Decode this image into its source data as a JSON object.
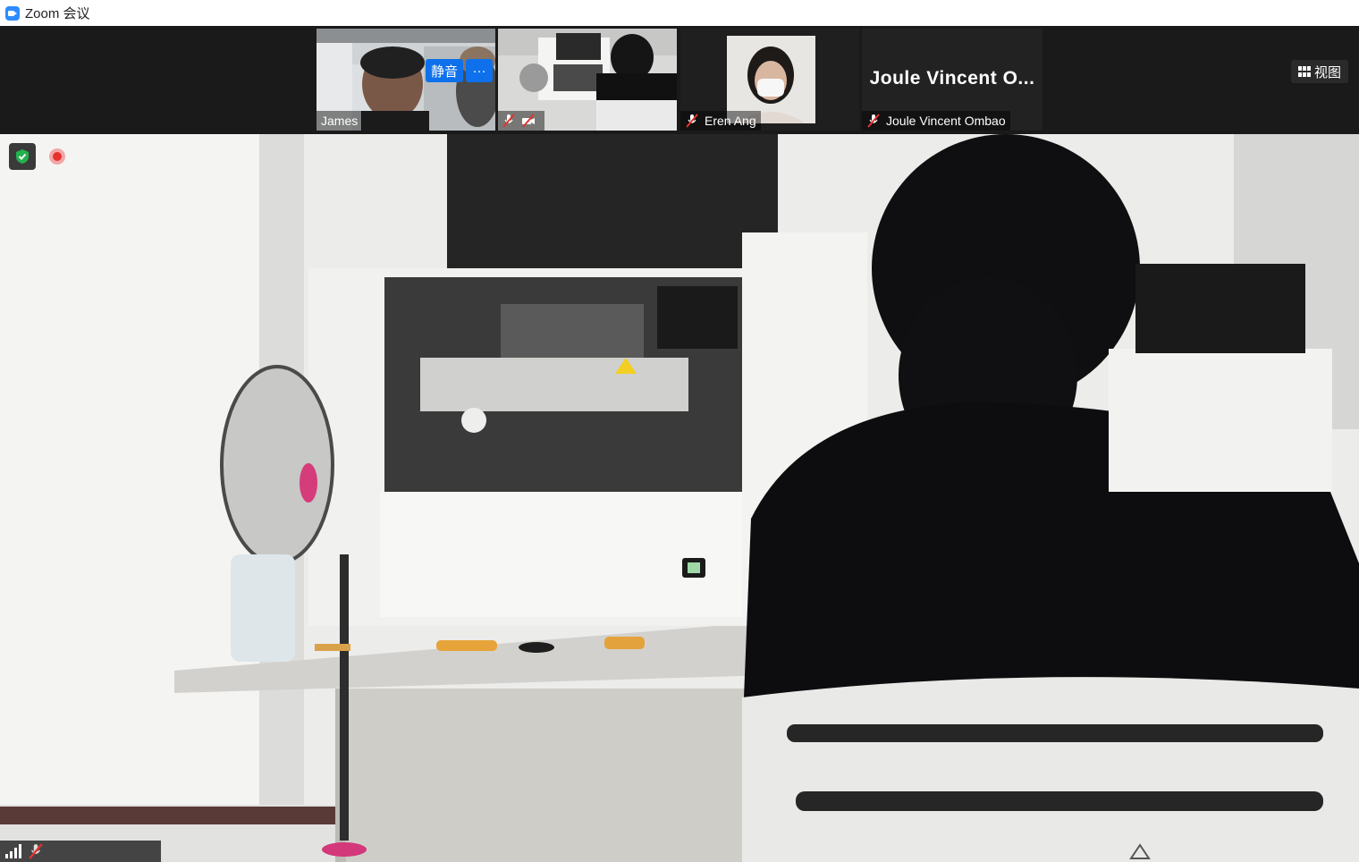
{
  "window": {
    "title": "Zoom 会议"
  },
  "toolbar": {
    "view_label": "视图"
  },
  "thumbnails": {
    "tile1": {
      "name": "James",
      "mute_button": "静音",
      "more_button": "···"
    },
    "tile2": {
      "name": ""
    },
    "tile3": {
      "name": "Eren Ang"
    },
    "tile4": {
      "display_name": "Joule Vincent O...",
      "name": "Joule Vincent Ombao"
    }
  },
  "colors": {
    "zoom_blue": "#0e71eb",
    "active_speaker_border": "#a6d65c",
    "muted_red": "#e5322d",
    "shield_green": "#23b14d"
  },
  "icons": {
    "app": "zoom-app-icon",
    "muted": "mic-muted-icon",
    "view": "grid-view-icon",
    "security": "shield-icon",
    "recording": "recording-icon",
    "signal": "signal-strength-icon"
  }
}
